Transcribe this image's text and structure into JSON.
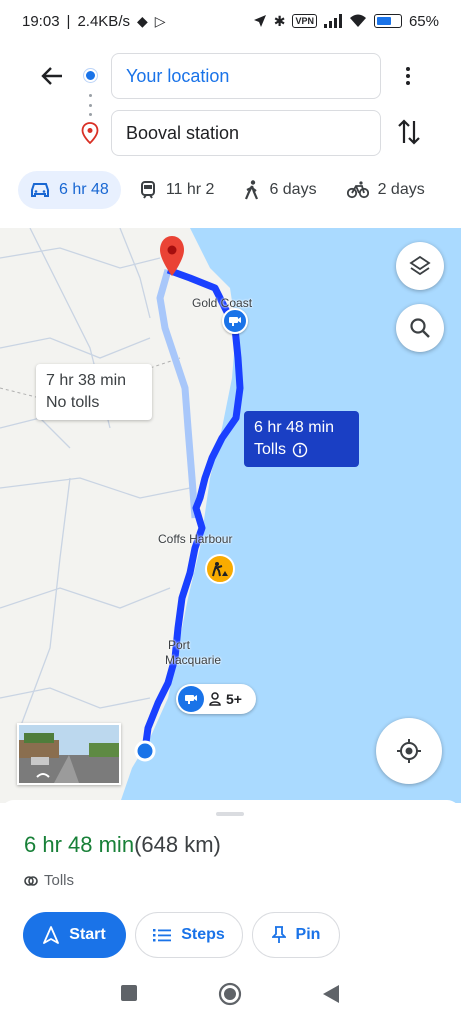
{
  "status_bar": {
    "time": "19:03",
    "speed": "2.4KB/s",
    "vpn": "VPN",
    "battery": "65%",
    "battery_level": 0.65
  },
  "search": {
    "from_label": "Your location",
    "to_label": "Booval station"
  },
  "modes": [
    {
      "icon": "car-icon",
      "label": "6 hr 48",
      "active": true
    },
    {
      "icon": "train-icon",
      "label": "11 hr 2",
      "active": false
    },
    {
      "icon": "walk-icon",
      "label": "6 days",
      "active": false
    },
    {
      "icon": "bike-icon",
      "label": "2 days",
      "active": false
    }
  ],
  "map": {
    "labels": {
      "gold_coast": "Gold Coast",
      "coffs": "Coffs Harbour",
      "port": "Port",
      "macquarie": "Macquarie"
    },
    "alt_route": {
      "line1": "7 hr 38 min",
      "line2": "No tolls"
    },
    "main_route": {
      "line1": "6 hr 48 min",
      "line2": "Tolls"
    },
    "report_chip": {
      "count": "5+"
    },
    "colors": {
      "route": "#1a40ff",
      "alt_route": "#a8c7fa",
      "water": "#aadaff",
      "land": "#f3f3f0"
    }
  },
  "sheet": {
    "duration": "6 hr 48 min",
    "distance": "(648 km)",
    "tolls": "Tolls",
    "start": "Start",
    "steps": "Steps",
    "pin": "Pin"
  }
}
